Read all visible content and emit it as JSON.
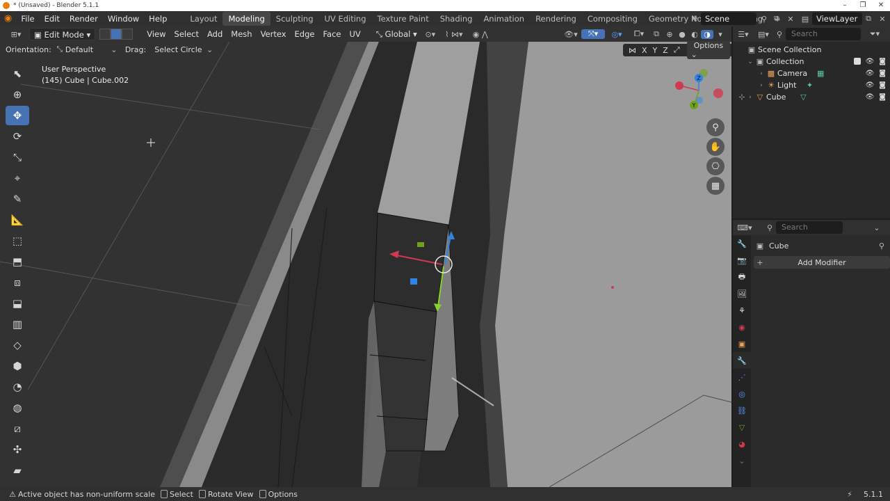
{
  "window": {
    "title": "* (Unsaved) - Blender 5.1.1",
    "minimize": "–",
    "maximize": "❐",
    "close": "✕"
  },
  "menu": [
    "File",
    "Edit",
    "Render",
    "Window",
    "Help"
  ],
  "workspaces": [
    "Layout",
    "Modeling",
    "Sculpting",
    "UV Editing",
    "Texture Paint",
    "Shading",
    "Animation",
    "Rendering",
    "Compositing",
    "Geometry Nodes",
    "Scripting"
  ],
  "active_workspace": "Modeling",
  "add_workspace": "+",
  "scene": "Scene",
  "view_layer": "ViewLayer",
  "viewport_header": {
    "mode": "Edit Mode",
    "menus": [
      "View",
      "Select",
      "Add",
      "Mesh",
      "Vertex",
      "Edge",
      "Face",
      "UV"
    ],
    "transform_orientation": "Global",
    "orientation_label": "Orientation:",
    "orientation_value": "Default",
    "drag_label": "Drag:",
    "drag_value": "Select Circle",
    "mirror_axes": [
      "X",
      "Y",
      "Z"
    ],
    "options": "Options"
  },
  "viewport_overlay": {
    "view_name": "User Perspective",
    "object_info": "(145) Cube | Cube.002"
  },
  "gizmo_axes": [
    "Z",
    "Y"
  ],
  "outliner": {
    "search_placeholder": "Search",
    "root": "Scene Collection",
    "items": [
      {
        "label": "Collection",
        "icon": "collection-icon"
      },
      {
        "label": "Camera",
        "icon": "camera-icon"
      },
      {
        "label": "Light",
        "icon": "light-icon"
      },
      {
        "label": "Cube",
        "icon": "mesh-icon"
      }
    ]
  },
  "properties": {
    "search_placeholder": "Search",
    "object_name": "Cube",
    "add_modifier": "Add Modifier"
  },
  "status": {
    "warning": "Active object has non-uniform scale",
    "hints": [
      "Select",
      "Rotate View",
      "Options"
    ],
    "version": "5.1.1"
  },
  "colors": {
    "accent": "#4772b3",
    "blender_orange": "#e87d0d",
    "axis_x": "#d0394f",
    "axis_y": "#6ea21d",
    "axis_z": "#2f83e3"
  }
}
